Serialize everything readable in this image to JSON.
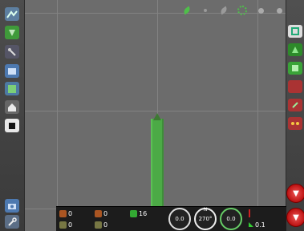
{
  "map": {
    "status_icons": [
      "leaf-icon",
      "dot-icon",
      "leaf-gray-icon",
      "gear-icon",
      "gps-icon",
      "dot-icon"
    ]
  },
  "left_bar": {
    "icons": [
      "globe-icon",
      "guidance-icon",
      "tools-icon",
      "screen-icon",
      "field-icon",
      "home-icon",
      "black-square-icon",
      "camera-icon",
      "settings-wrench-icon"
    ]
  },
  "right_bar": {
    "icons": [
      "view-icon",
      "coverage-icon",
      "field-icon",
      "blank-icon",
      "pen-icon",
      "tram-icon"
    ],
    "down_button": "▼",
    "down_button_2": "▼"
  },
  "bottom": {
    "r1_a": "0",
    "r1_b": "0",
    "r1_c": "16",
    "r2_a": "0",
    "r2_b": "0",
    "gauge_left": "0.0",
    "gauge_mid": "270°",
    "gauge_mid_top": "N",
    "gauge_right": "0.0",
    "right_top": "",
    "right_val": "0.1"
  },
  "colors": {
    "coverage": "#4caa46",
    "accent_red": "#cc2222"
  }
}
